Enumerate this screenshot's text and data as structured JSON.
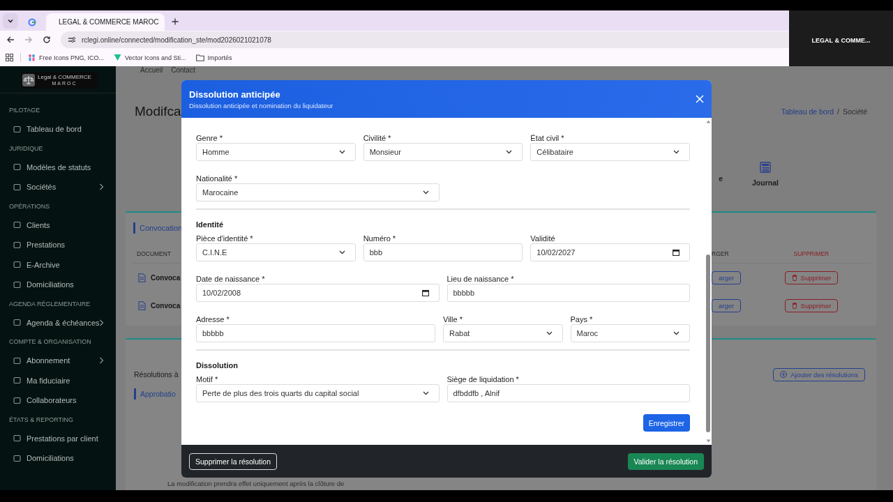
{
  "browser": {
    "tabs": [
      {
        "kind": "icon",
        "selected": false
      },
      {
        "kind": "page",
        "title": "LEGAL & COMMERCE MAROC",
        "selected": true
      }
    ],
    "url": "rclegi.online/connected/modification_ste/mod2026021021078",
    "bookmarks": [
      {
        "kind": "link",
        "label": "Free Icons PNG, ICO..."
      },
      {
        "kind": "link",
        "label": "Vector Icons and Sti..."
      },
      {
        "kind": "folder",
        "label": "Importés"
      }
    ],
    "overlay_title": "LEGAL & COMME..."
  },
  "sidebar": {
    "logo": {
      "name": "Legal & COMMERCE",
      "tagline": "MAROC"
    },
    "sections": [
      {
        "title": "PILOTAGE",
        "items": [
          {
            "label": "Tableau de bord",
            "submenu": false
          }
        ]
      },
      {
        "title": "JURIDIQUE",
        "items": [
          {
            "label": "Modèles de statuts",
            "submenu": false
          },
          {
            "label": "Sociétés",
            "submenu": true
          }
        ]
      },
      {
        "title": "OPÉRATIONS",
        "items": [
          {
            "label": "Clients",
            "submenu": false
          },
          {
            "label": "Prestations",
            "submenu": false
          },
          {
            "label": "E-Archive",
            "submenu": false
          },
          {
            "label": "Domiciliations",
            "submenu": false
          }
        ]
      },
      {
        "title": "AGENDA RÉGLEMENTAIRE",
        "items": [
          {
            "label": "Agenda & échéances",
            "submenu": true
          }
        ]
      },
      {
        "title": "COMPTE & ORGANISATION",
        "items": [
          {
            "label": "Abonnement",
            "submenu": true
          },
          {
            "label": "Ma fiduciaire",
            "submenu": false
          },
          {
            "label": "Collaborateurs",
            "submenu": false
          }
        ]
      },
      {
        "title": "ÉTATS & REPORTING",
        "items": [
          {
            "label": "Prestations par client",
            "submenu": false
          },
          {
            "label": "Domiciliations",
            "submenu": false
          }
        ]
      }
    ]
  },
  "page": {
    "top_nav": [
      "Accueil",
      "Contact"
    ],
    "title": "Modifca",
    "breadcrumb_separator": "/",
    "breadcrumb": [
      {
        "label": "Tableau de bord",
        "link": true
      },
      {
        "label": "Société",
        "link": false
      }
    ],
    "nav_tabs": [
      {
        "label": "e",
        "icon": false
      },
      {
        "label": "Journal",
        "icon": true
      }
    ],
    "convocations": {
      "tab": "Convocation",
      "columns": [
        "DOCUMENT",
        "RGER",
        "SUPPRIMER"
      ],
      "rows": [
        {
          "document": "Convoca",
          "download": "arger",
          "delete": "Supprimer"
        },
        {
          "document": "Convoca",
          "download": "arger",
          "delete": "Supprimer"
        }
      ]
    },
    "resolutions": {
      "title": "Résolutions à",
      "tab": "Approbatio",
      "add_button": "Ajouter des résolutions",
      "note": "La modification prendra effet uniquement après la clôture de"
    }
  },
  "modal": {
    "title": "Dissolution anticipée",
    "subtitle": "Dissolution anticipée et nomination du liquidateur",
    "sections": [
      {
        "rows": [
          {
            "kind": "thirds",
            "fields": [
              {
                "label": "Genre *",
                "kind": "select",
                "value": "Homme"
              },
              {
                "label": "Civilité *",
                "kind": "select",
                "value": "Monsieur"
              },
              {
                "label": "État civil *",
                "kind": "select",
                "value": "Célibataire"
              }
            ]
          },
          {
            "kind": "halves",
            "fields": [
              {
                "label": "Nationalité *",
                "kind": "select",
                "value": "Marocaine"
              }
            ]
          }
        ]
      },
      {
        "heading": "Identité",
        "rows": [
          {
            "kind": "thirds",
            "fields": [
              {
                "label": "Pièce d'identité *",
                "kind": "select",
                "value": "C.I.N.E"
              },
              {
                "label": "Numéro *",
                "kind": "text",
                "value": "bbb"
              },
              {
                "label": "Validité",
                "kind": "date",
                "value": "10/02/2027"
              }
            ]
          },
          {
            "kind": "halves",
            "fields": [
              {
                "label": "Date de naissance *",
                "kind": "date",
                "value": "10/02/2008"
              },
              {
                "label": "Lieu de naissance *",
                "kind": "text",
                "value": "bbbbb"
              }
            ]
          },
          {
            "kind": "half-quarters",
            "fields": [
              {
                "label": "Adresse *",
                "kind": "text",
                "value": "bbbbb"
              },
              {
                "label": "Ville *",
                "kind": "select",
                "value": "Rabat"
              },
              {
                "label": "Pays *",
                "kind": "select",
                "value": "Maroc"
              }
            ]
          }
        ]
      },
      {
        "heading": "Dissolution",
        "rows": [
          {
            "kind": "halves",
            "fields": [
              {
                "label": "Motif *",
                "kind": "select",
                "value": "Perte de plus des trois quarts du capital social"
              },
              {
                "label": "Siège de liquidation *",
                "kind": "text",
                "value": "dfbddfb , Alnif"
              }
            ]
          }
        ]
      }
    ],
    "save_button": "Enregistrer",
    "footer": {
      "delete_button": "Supprimer la résolution",
      "validate_button": "Valider la résolution"
    }
  }
}
